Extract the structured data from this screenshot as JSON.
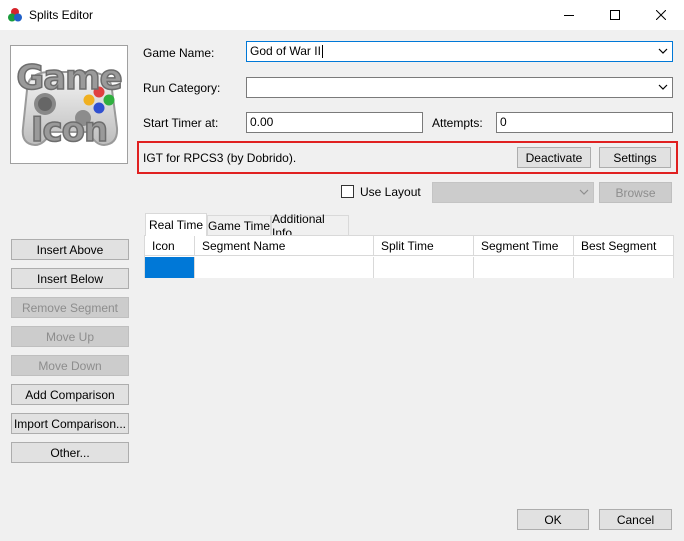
{
  "window": {
    "title": "Splits Editor",
    "minimize_glyph": "—",
    "maximize_glyph": "☐",
    "close_glyph": "✕"
  },
  "game_icon": {
    "line1": "Game",
    "line2": "Icon"
  },
  "form": {
    "game_name_label": "Game Name:",
    "game_name_value": "God of War II",
    "run_category_label": "Run Category:",
    "run_category_value": "",
    "start_timer_label": "Start Timer at:",
    "start_timer_value": "0.00",
    "attempts_label": "Attempts:",
    "attempts_value": "0"
  },
  "component": {
    "description": "IGT for RPCS3 (by Dobrido).",
    "deactivate_label": "Deactivate",
    "settings_label": "Settings"
  },
  "layout": {
    "use_layout_label": "Use Layout",
    "use_layout_checked": false,
    "layout_value": "",
    "browse_label": "Browse"
  },
  "tabs": [
    {
      "label": "Real Time",
      "active": true
    },
    {
      "label": "Game Time",
      "active": false
    },
    {
      "label": "Additional Info",
      "active": false
    }
  ],
  "grid": {
    "columns": [
      "Icon",
      "Segment Name",
      "Split Time",
      "Segment Time",
      "Best Segment"
    ],
    "selected_color": "#0078d7"
  },
  "side_buttons": {
    "insert_above": "Insert Above",
    "insert_below": "Insert Below",
    "remove_segment": "Remove Segment",
    "move_up": "Move Up",
    "move_down": "Move Down",
    "add_comparison": "Add Comparison",
    "import_comparison": "Import Comparison...",
    "other": "Other..."
  },
  "footer": {
    "ok_label": "OK",
    "cancel_label": "Cancel"
  },
  "colors": {
    "highlight_border": "#e02020",
    "selection": "#0078d7"
  }
}
